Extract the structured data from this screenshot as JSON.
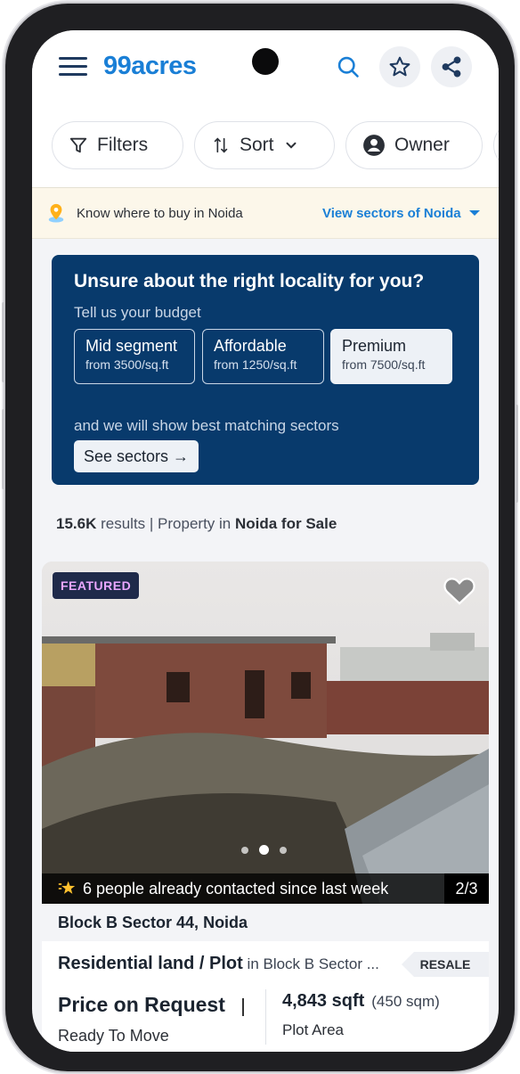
{
  "header": {
    "logo": "99acres"
  },
  "chips": [
    {
      "label": "Filters",
      "icon": "filter-icon"
    },
    {
      "label": "Sort",
      "icon": "sort-icon"
    },
    {
      "label": "Owner",
      "icon": "user-icon"
    }
  ],
  "notice": {
    "text": "Know where to buy in Noida",
    "link": "View sectors of Noida"
  },
  "promo": {
    "title": "Unsure about the right locality for you?",
    "subtitle": "Tell us your budget",
    "segments": [
      {
        "title": "Mid segment",
        "price": "from 3500/sq.ft"
      },
      {
        "title": "Affordable",
        "price": "from 1250/sq.ft"
      },
      {
        "title": "Premium",
        "price": "from 7500/sq.ft"
      }
    ],
    "note": "and we will show best matching sectors",
    "button": "See sectors →"
  },
  "results": {
    "count": "15.6K",
    "results_word": " results",
    "separator": " | ",
    "prefix": "Property in ",
    "location": "Noida for Sale"
  },
  "listing": {
    "badge": "FEATURED",
    "contact_text": "6 people already contacted since last week",
    "photo_counter": "2/3",
    "locality": "Block B Sector 44, Noida",
    "type": "Residential land / Plot",
    "type_in": " in Block B Sector ...",
    "tag": "RESALE",
    "price": "Price on Request",
    "status": "Ready To Move",
    "area": "4,843 sqft",
    "area_sqm": "(450 sqm)",
    "area_label": "Plot Area"
  },
  "colors": {
    "brand_blue": "#1a7fd6",
    "promo_bg": "#083a6c",
    "notice_bg": "#fcf7ea",
    "badge_text": "#e9a7ff"
  }
}
